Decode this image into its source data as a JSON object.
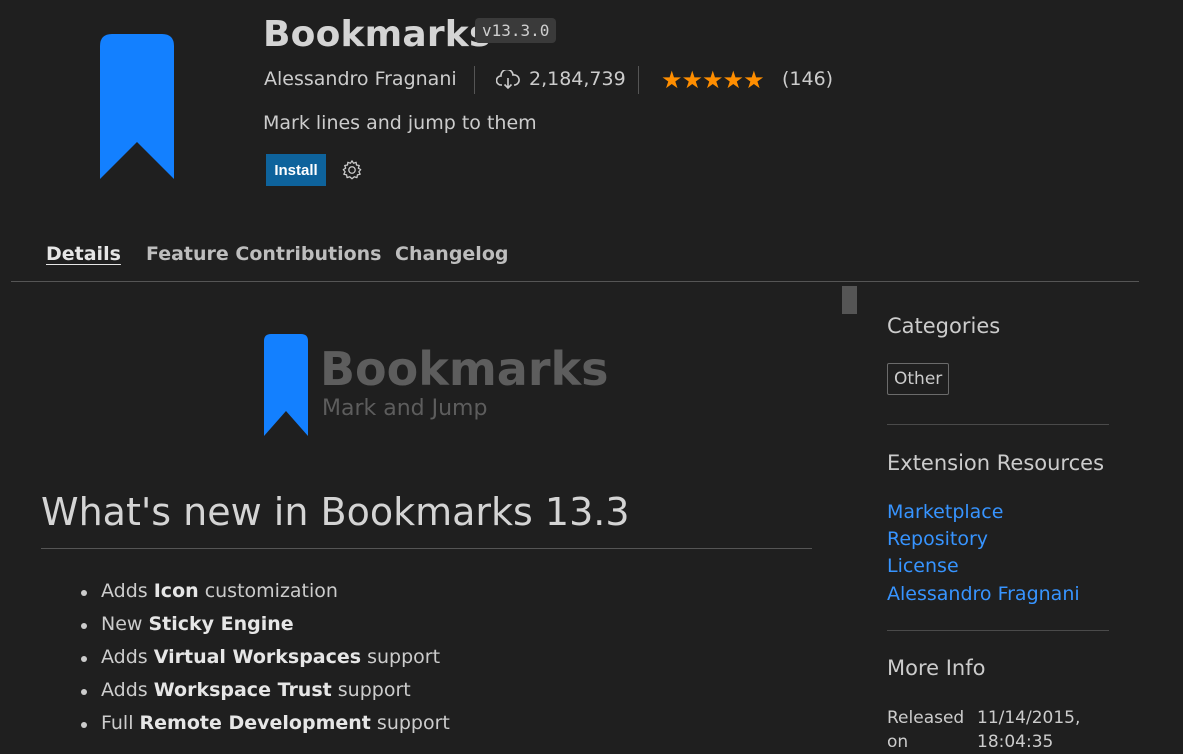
{
  "header": {
    "name": "Bookmarks",
    "version": "v13.3.0",
    "publisher": "Alessandro Fragnani",
    "installs": "2,184,739",
    "rating_stars": "★★★★★",
    "rating_value": 4.5,
    "rating_count": "(146)",
    "description": "Mark lines and jump to them",
    "install_label": "Install",
    "accent": "#1380ff"
  },
  "tabs": [
    {
      "label": "Details"
    },
    {
      "label": "Feature Contributions"
    },
    {
      "label": "Changelog"
    }
  ],
  "readme": {
    "logo_title": "Bookmarks",
    "logo_subtitle": "Mark and Jump",
    "heading": "What's new in Bookmarks 13.3",
    "features": [
      {
        "pre": "Adds ",
        "bold": "Icon",
        "post": " customization"
      },
      {
        "pre": "New ",
        "bold": "Sticky Engine",
        "post": ""
      },
      {
        "pre": "Adds ",
        "bold": "Virtual Workspaces",
        "post": " support"
      },
      {
        "pre": "Adds ",
        "bold": "Workspace Trust",
        "post": " support"
      },
      {
        "pre": "Full ",
        "bold": "Remote Development",
        "post": " support"
      }
    ]
  },
  "sidebar": {
    "categories_title": "Categories",
    "category": "Other",
    "resources_title": "Extension Resources",
    "links": [
      "Marketplace",
      "Repository",
      "License",
      "Alessandro Fragnani"
    ],
    "more_info_title": "More Info",
    "released_label": "Released on",
    "released_value": "11/14/2015, 18:04:35"
  },
  "icons": {
    "extension": "bookmark-icon",
    "downloads": "cloud-download-icon",
    "settings": "gear-icon"
  }
}
